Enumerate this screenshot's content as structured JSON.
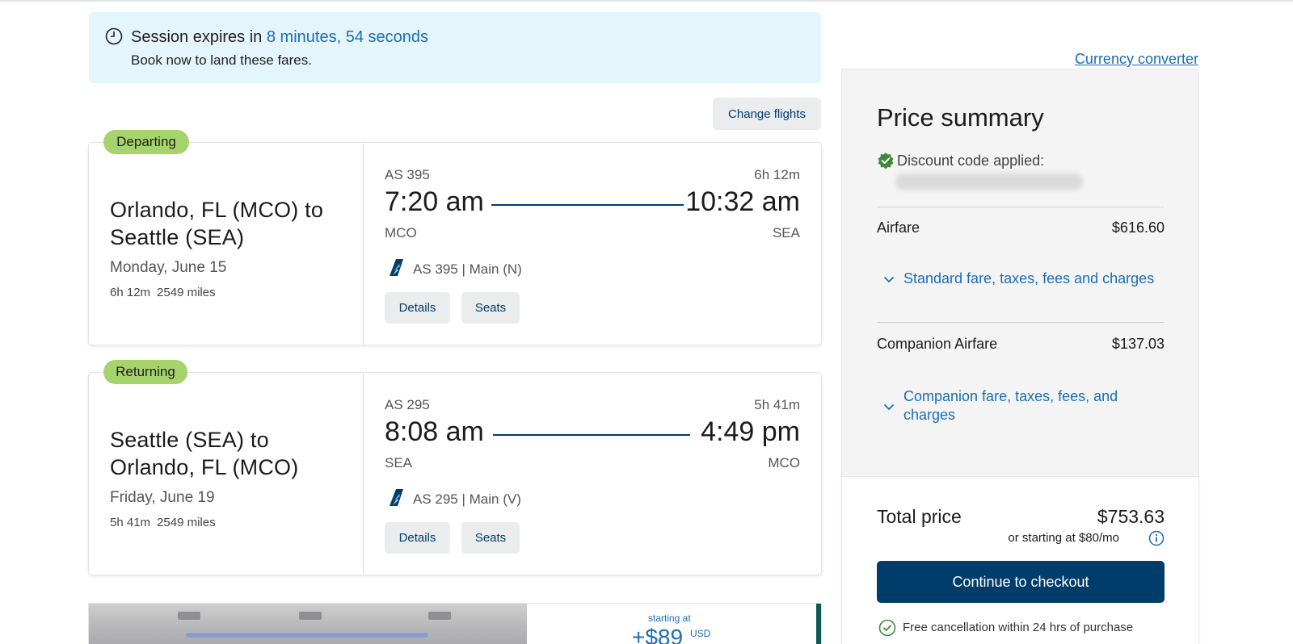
{
  "session": {
    "prefix": "Session expires in",
    "countdown": "8 minutes, 54 seconds",
    "subtext": "Book now to land these fares."
  },
  "change_flights_label": "Change flights",
  "flights": {
    "departing": {
      "badge": "Departing",
      "route": "Orlando, FL (MCO) to Seattle (SEA)",
      "date": "Monday, June 15",
      "duration_short": "6h 12m",
      "miles": "2549 miles",
      "flight_number": "AS 395",
      "duration": "6h 12m",
      "depart_time": "7:20 am",
      "arrive_time": "10:32 am",
      "depart_code": "MCO",
      "arrive_code": "SEA",
      "cabin": "AS 395 | Main (N)",
      "details_label": "Details",
      "seats_label": "Seats"
    },
    "returning": {
      "badge": "Returning",
      "route": "Seattle (SEA) to Orlando, FL (MCO)",
      "date": "Friday, June 19",
      "duration_short": "5h 41m",
      "miles": "2549 miles",
      "flight_number": "AS 295",
      "duration": "5h 41m",
      "depart_time": "8:08 am",
      "arrive_time": "4:49 pm",
      "depart_code": "SEA",
      "arrive_code": "MCO",
      "cabin": "AS 295 | Main (V)",
      "details_label": "Details",
      "seats_label": "Seats"
    }
  },
  "promo": {
    "starting_at": "starting at",
    "price": "+$89",
    "currency": "USD"
  },
  "price_summary": {
    "currency_converter": "Currency converter",
    "title": "Price summary",
    "discount_label": "Discount code applied:",
    "airfare_label": "Airfare",
    "airfare_value": "$616.60",
    "airfare_expand": "Standard fare, taxes, fees and charges",
    "companion_label": "Companion Airfare",
    "companion_value": "$137.03",
    "companion_expand": "Companion fare, taxes, fees, and charges",
    "total_label": "Total price",
    "total_value": "$753.63",
    "monthly": "or starting at $80/mo",
    "checkout_label": "Continue to checkout",
    "free_cancellation": "Free cancellation within 24 hrs of purchase"
  },
  "colors": {
    "brand_navy": "#003d6b",
    "link_blue": "#1a6eb5",
    "badge_green": "#a6d36b",
    "banner_bg": "#e5f5fc"
  }
}
